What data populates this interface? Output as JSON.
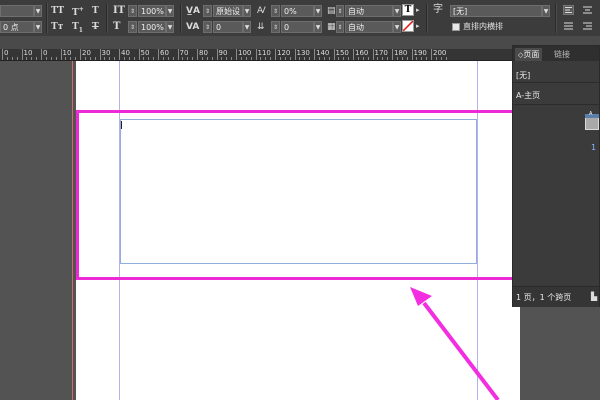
{
  "control_bar": {
    "leading_value": "0 点",
    "font_size_value": "100%",
    "vscale_value": "100%",
    "kerning_value": "原始设",
    "tracking_value": "0",
    "skew_value": "0%",
    "baseline_value": "0",
    "auto_top": "自动",
    "auto_bottom": "自动",
    "char_style_value": "[无]",
    "tate_chu_yoko_label": "直排内横排"
  },
  "ruler": {
    "ticks": [
      "0",
      "10",
      "0",
      "10",
      "20",
      "30",
      "40",
      "50",
      "60",
      "70",
      "80",
      "90",
      "100",
      "110",
      "120",
      "130",
      "140",
      "150",
      "160",
      "170",
      "180",
      "190",
      "200"
    ]
  },
  "pages_panel": {
    "tab_pages": "页面",
    "tab_links": "链接",
    "none_item": "[无]",
    "master_item": "A-主页",
    "page_number": "1",
    "thumb_label": "A",
    "footer": "1 页，1 个跨页"
  },
  "colors": {
    "highlight": "#ee2ad6",
    "arrow": "#f22ee0",
    "frame_border": "#8fb0dc",
    "guide": "#b8b0ea"
  }
}
